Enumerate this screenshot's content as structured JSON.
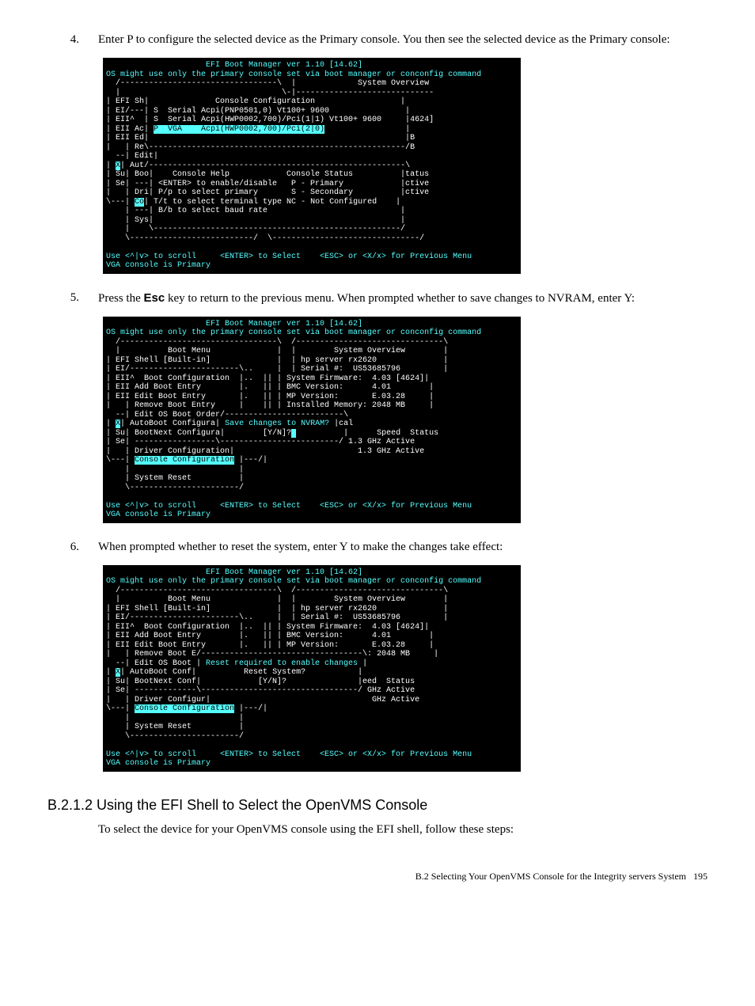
{
  "steps": {
    "s4": {
      "num": "4.",
      "text_a": "Enter P to configure the selected device as the Primary console. You then see the selected device as the Primary console:"
    },
    "s5": {
      "num": "5.",
      "text_a": "Press the ",
      "esc": "Esc",
      "text_b": " key to return to the previous menu. When prompted whether to save changes to NVRAM, enter Y:"
    },
    "s6": {
      "num": "6.",
      "text_a": "When prompted whether to reset the system, enter Y to make the changes take effect:"
    }
  },
  "term1": {
    "title": "                     EFI Boot Manager ver 1.10 [14.62]",
    "warn": "OS might use only the primary console set via boot manager or conconfig command",
    "l1": "  /---------------------------------\\  |             System Overview",
    "l2": "  |                                  \\-|-----------------------------",
    "l3": "| EFI Sh|              Console Configuration                  |",
    "l4": "| EI/---| S  Serial Acpi(PNP0501,0) Vt100+ 9600                |",
    "l5": "| EII^  | S  Serial Acpi(HWP0002,700)/Pci(1|1) Vt100+ 9600     |4624]",
    "l6a": "| EII Ac| ",
    "l6b": "P  VGA    Acpi(HWP0002,700)/Pci(2|0)",
    "l6c": "                 |",
    "l7": "| EII Ed|                                                      |B",
    "l8": "|   | Re\\------------------------------------------------------/B",
    "l9": "  --| Edit|",
    "l10a": "| ",
    "l10b": "X",
    "l10c": "| Aut/------------------------------------------------------\\",
    "l11": "| Su| Boo|    Console Help            Console Status          |tatus",
    "l12": "| Se| ---| <ENTER> to enable/disable   P - Primary            |ctive",
    "l13": "|   | Dri| P/p to select primary       S - Secondary          |ctive",
    "l14a": "\\---| ",
    "l14b": "Co",
    "l14c": "| T/t to select terminal type NC - Not Configured    |",
    "l15": "    | ---| B/b to select baud rate                            |",
    "l16": "    | Sys|                                                    |",
    "l17": "    |    \\----------------------------------------------------/",
    "l18": "    \\--------------------------/  \\-------------------------------/",
    "foot1": "Use <^|v> to scroll     <ENTER> to Select    <ESC> or <X/x> for Previous Menu",
    "foot2": "VGA console is Primary"
  },
  "term2": {
    "title": "                     EFI Boot Manager ver 1.10 [14.62]",
    "warn": "OS might use only the primary console set via boot manager or conconfig command",
    "l1": "  /---------------------------------\\  /-------------------------------\\",
    "l2": "  |          Boot Menu              |  |        System Overview        |",
    "l3": "| EFI Shell [Built-in]              |  | hp server rx2620              |",
    "l4": "| EI/-----------------------\\..     |  | Serial #:  US53685796         |",
    "l5": "| EII^  Boot Configuration  |..  || | System Firmware:  4.03 [4624]|",
    "l6": "| EII Add Boot Entry        |.   || | BMC Version:      4.01        |",
    "l7": "| EII Edit Boot Entry       |.   || | MP Version:       E.03.28     |",
    "l8": "|   | Remove Boot Entry     |    || | Installed Memory: 2048 MB     |",
    "l9": "  --| Edit OS Boot Order/-------------------------\\",
    "l10a": "| ",
    "l10b": "X",
    "l10c": "| AutoBoot Configura| ",
    "l10d": "Save changes to NVRAM?",
    "l10e": " |cal",
    "l11a": "| Su| BootNext Configura|        [Y/N]?",
    "l11b": " ",
    "l11c": "          |      Speed  Status",
    "l12": "| Se| -----------------\\-------------------------/ 1.3 GHz Active",
    "l13": "|   | Driver Configuration|                          1.3 GHz Active",
    "l14a": "\\---| ",
    "l14b": "Console Configuration",
    "l14c": " |---/|",
    "l15": "    |                       |",
    "l16": "    | System Reset          |",
    "l17": "    \\-----------------------/",
    "foot1": "Use <^|v> to scroll     <ENTER> to Select    <ESC> or <X/x> for Previous Menu",
    "foot2": "VGA console is Primary"
  },
  "term3": {
    "title": "                     EFI Boot Manager ver 1.10 [14.62]",
    "warn": "OS might use only the primary console set via boot manager or conconfig command",
    "l1": "  /---------------------------------\\  /-------------------------------\\",
    "l2": "  |          Boot Menu              |  |        System Overview        |",
    "l3": "| EFI Shell [Built-in]              |  | hp server rx2620              |",
    "l4": "| EI/-----------------------\\..     |  | Serial #:  US53685796         |",
    "l5": "| EII^  Boot Configuration  |..  || | System Firmware:  4.03 [4624]|",
    "l6": "| EII Add Boot Entry        |.   || | BMC Version:      4.01        |",
    "l7": "| EII Edit Boot Entry       |.   || | MP Version:       E.03.28     |",
    "l8": "|   | Remove Boot E/----------------------------------\\: 2048 MB     |",
    "l9a": "  --| Edit OS Boot | ",
    "l9b": "Reset required to enable changes",
    "l9c": " |",
    "l10a": "| ",
    "l10b": "X",
    "l10c": "| AutoBoot Conf|          Reset System?           |",
    "l11": "| Su| BootNext Conf|            [Y/N]?               |eed  Status",
    "l12": "| Se| -------------\\---------------------------------/ GHz Active",
    "l13": "|   | Driver Configur|                                  GHz Active",
    "l14a": "\\---| ",
    "l14b": "Console Configuration",
    "l14c": " |---/|",
    "l15": "    |                       |",
    "l16": "    | System Reset          |",
    "l17": "    \\-----------------------/",
    "foot1": "Use <^|v> to scroll     <ENTER> to Select    <ESC> or <X/x> for Previous Menu",
    "foot2": "VGA console is Primary"
  },
  "section": {
    "heading": "B.2.1.2 Using the EFI Shell to Select the OpenVMS Console",
    "text": "To select the device for your OpenVMS console using the EFI shell, follow these steps:"
  },
  "footer": {
    "text": "B.2 Selecting Your OpenVMS Console for the Integrity servers System",
    "page": "195"
  }
}
